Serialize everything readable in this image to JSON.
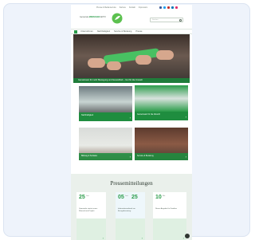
{
  "topbar": {
    "utility_links": [
      "Presse & Medienservice",
      "Karriere",
      "Kontakt",
      "Impressum"
    ],
    "social_colors": [
      "#3b5998",
      "#1da1f2",
      "#c4302b",
      "#0077b5",
      "#e1306c"
    ],
    "logo_text_line1": "Gemeinde",
    "logo_text_line2": "MENSCHEN",
    "logo_text_line3": "AKTIV",
    "search_placeholder": "Suchen"
  },
  "nav": {
    "items": [
      "Unternehmen",
      "Nachhaltigkeit",
      "Service & Beratung",
      "Presse"
    ]
  },
  "hero": {
    "caption": "Gemeinsam für mehr Bewegung und Gesundheit – Gut für die Umwelt"
  },
  "tiles": [
    {
      "label": "Nachhaltigkeit"
    },
    {
      "label": "Gemeinsam für die Zukunft"
    },
    {
      "label": "Bildung & Soziales"
    },
    {
      "label": "Service & Beratung"
    }
  ],
  "news": {
    "title": "Pressemitteilungen",
    "items": [
      {
        "day": "25",
        "month": "Juni",
        "text": "Gemeinde startet neues Klimaschutz-Projekt"
      },
      {
        "day": "05",
        "day2": "25",
        "month": "Juni",
        "text": "Informationsabend zur Energieberatung"
      },
      {
        "day": "10",
        "month": "Mai",
        "text": "Neues Angebot für Familien"
      }
    ]
  },
  "colors": {
    "brand_green": "#2b9c4a",
    "dark_green": "#1f8d3f",
    "background": "#eef3fb"
  }
}
